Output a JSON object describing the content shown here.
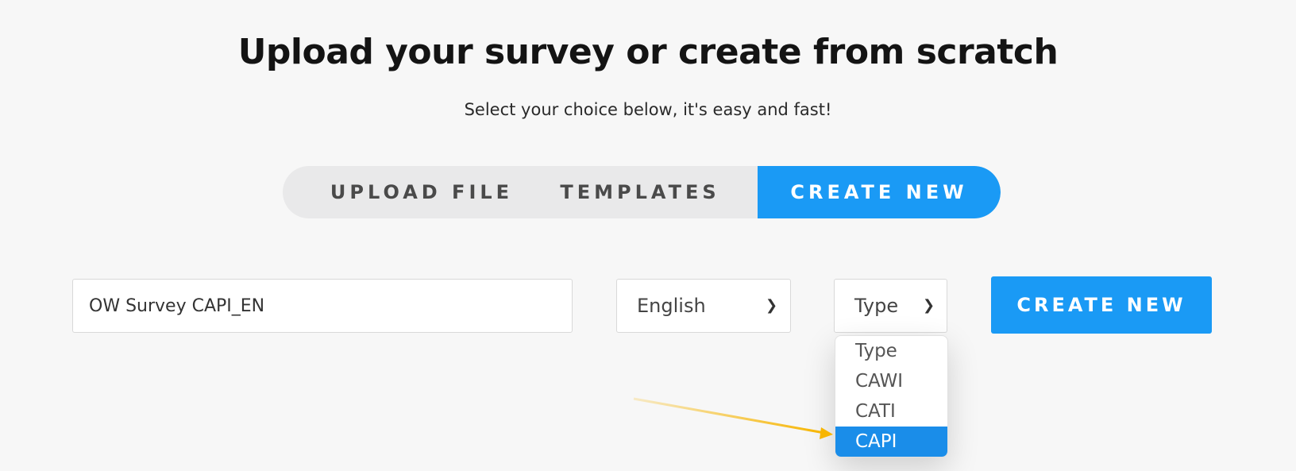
{
  "header": {
    "title": "Upload your survey or create from scratch",
    "subtitle": "Select your choice below, it's easy and fast!"
  },
  "tabs": [
    {
      "label": "UPLOAD FILE",
      "active": false
    },
    {
      "label": "TEMPLATES",
      "active": false
    },
    {
      "label": "CREATE NEW",
      "active": true
    }
  ],
  "form": {
    "name_value": "OW Survey CAPI_EN",
    "language_selected": "English",
    "type_selected": "Type",
    "type_options": [
      "Type",
      "CAWI",
      "CATI",
      "CAPI"
    ],
    "type_highlighted": "CAPI",
    "create_label": "CREATE NEW"
  },
  "icons": {
    "select_chevron": "chevron-down-icon",
    "annotation": "arrow-icon"
  },
  "colors": {
    "accent": "#1a9af5",
    "dropdown_highlight": "#1a8de9",
    "annotation_arrow": "#f7b500",
    "background": "#f7f7f7"
  }
}
